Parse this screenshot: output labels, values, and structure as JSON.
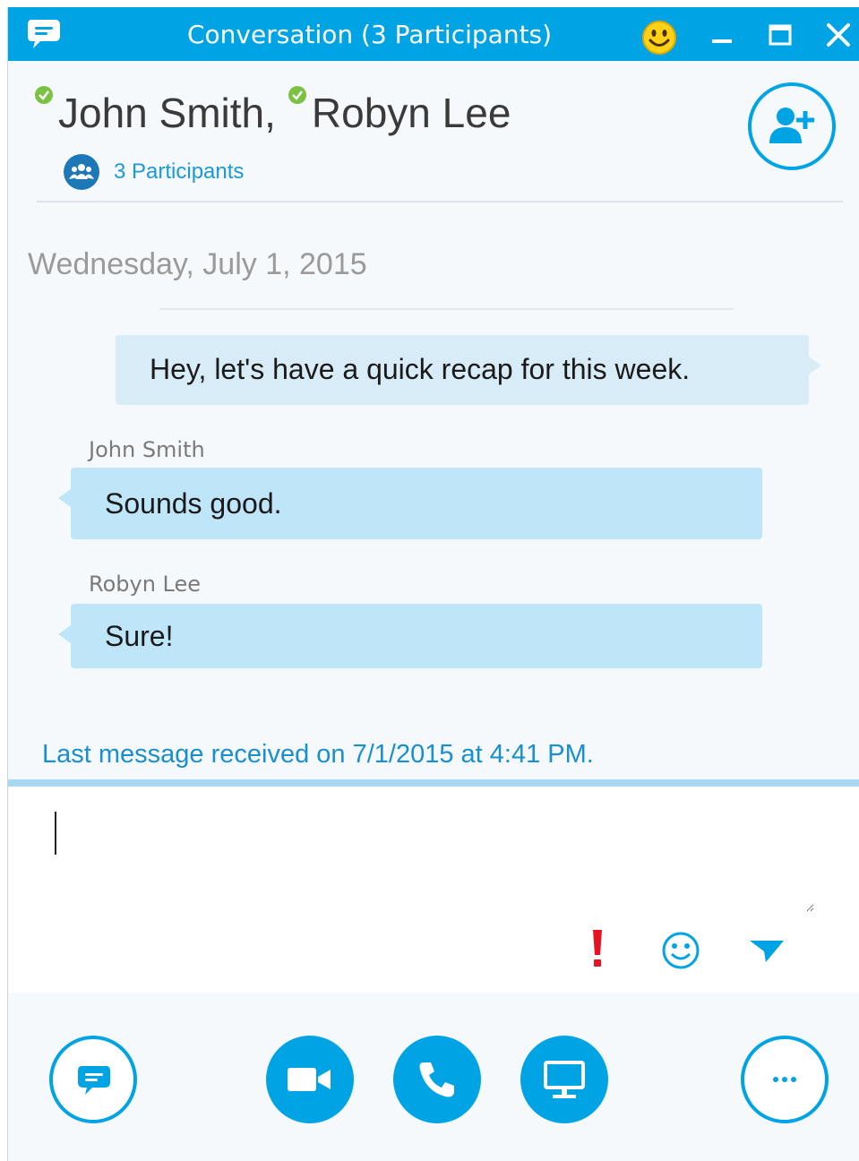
{
  "window": {
    "title": "Conversation (3 Participants)",
    "icons": [
      "chat-app-icon",
      "emoji-icon",
      "minimize-icon",
      "maximize-icon",
      "close-icon"
    ]
  },
  "header": {
    "participants": [
      {
        "name": "John Smith,",
        "presence": "available"
      },
      {
        "name": "Robyn Lee",
        "presence": "available"
      }
    ],
    "participant_count_label": "3 Participants",
    "add_person_icon": "add-person-icon"
  },
  "conversation": {
    "date": "Wednesday, July 1, 2015",
    "messages": [
      {
        "sender": "",
        "text": "Hey, let's have a quick recap for this week.",
        "direction": "outgoing"
      },
      {
        "sender": "John Smith",
        "text": "Sounds good.",
        "direction": "incoming"
      },
      {
        "sender": "Robyn Lee",
        "text": "Sure!",
        "direction": "incoming"
      }
    ],
    "status": "Last message received on 7/1/2015 at 4:41 PM."
  },
  "compose": {
    "value": "",
    "icons": [
      "important-icon",
      "emoticon-icon",
      "send-icon"
    ]
  },
  "toolbar": {
    "buttons": [
      "im-icon",
      "video-icon",
      "phone-icon",
      "present-icon",
      "more-icon"
    ]
  },
  "colors": {
    "accent": "#00a4e4",
    "presence_available": "#7bc142",
    "bubble_incoming": "#bfe6f8",
    "bubble_outgoing": "#d7ecf7",
    "link": "#1a8fcf",
    "important": "#e81123"
  }
}
